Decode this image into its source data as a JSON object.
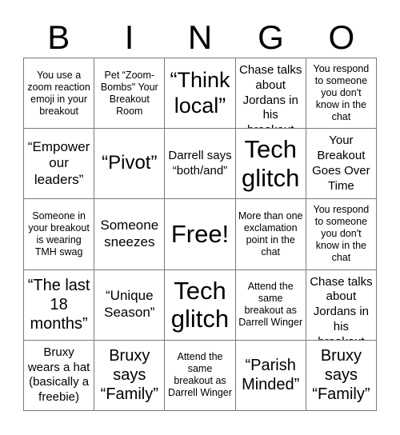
{
  "header": {
    "letters": [
      "B",
      "I",
      "N",
      "G",
      "O"
    ]
  },
  "cells": [
    [
      "You use a zoom reaction emoji in your breakout",
      "Pet “Zoom-Bombs\" Your Breakout Room",
      "“Think local”",
      "Chris Chase talks about Jordans in his breakout",
      "You respond to someone you don't know in the chat"
    ],
    [
      "“Empower our leaders”",
      "“Pivot”",
      "Darrell says “both/and”",
      "Tech glitch",
      "Your Breakout Goes Over Time"
    ],
    [
      "Someone in your breakout is wearing TMH swag",
      "Someone sneezes",
      "Free!",
      "More than one exclamation point in the chat",
      "You respond to someone you don't know in the chat"
    ],
    [
      "“The last 18 months”",
      "“Unique Season”",
      "Tech glitch",
      "Attend the same breakout as Darrell Winger",
      "Chris Chase talks about Jordans in his breakout"
    ],
    [
      "Bruxy wears a hat (basically a freebie)",
      "Bruxy says “Family”",
      "Attend the same breakout as Darrell Winger",
      "“Parish Minded”",
      "Bruxy says “Family”"
    ]
  ]
}
